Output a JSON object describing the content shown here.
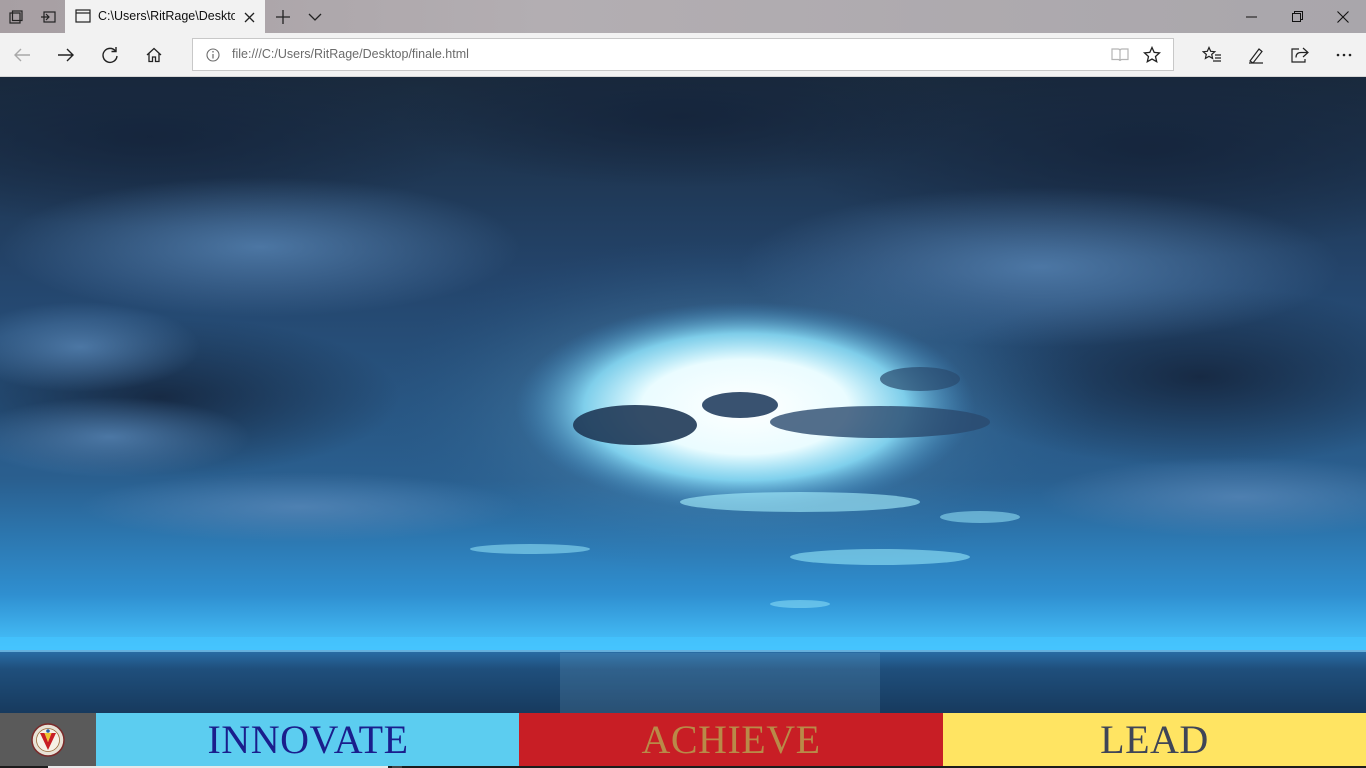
{
  "browser": {
    "tab": {
      "title": "C:\\Users\\RitRage\\Desktop\\finale.html"
    },
    "address_bar": {
      "url": "file:///C:/Users/RitRage/Desktop/finale.html"
    },
    "toolbar_icons": [
      "back-icon",
      "forward-icon",
      "refresh-icon",
      "home-icon",
      "reading-view-icon",
      "favorite-star-icon",
      "favorites-list-icon",
      "pen-icon",
      "share-icon",
      "more-icon"
    ],
    "window_icons": [
      "minimize-icon",
      "restore-icon",
      "close-icon"
    ]
  },
  "page": {
    "background": "night sky over ocean with clouds",
    "nav": [
      {
        "label": "INNOVATE",
        "bg": "#5ccdf0",
        "color": "#1a1e8c"
      },
      {
        "label": "ACHIEVE",
        "bg": "#c81e25",
        "color": "#b98a48"
      },
      {
        "label": "LEAD",
        "bg": "#ffe462",
        "color": "#3f4557"
      }
    ],
    "logo_bg": "#5a5a5a"
  }
}
